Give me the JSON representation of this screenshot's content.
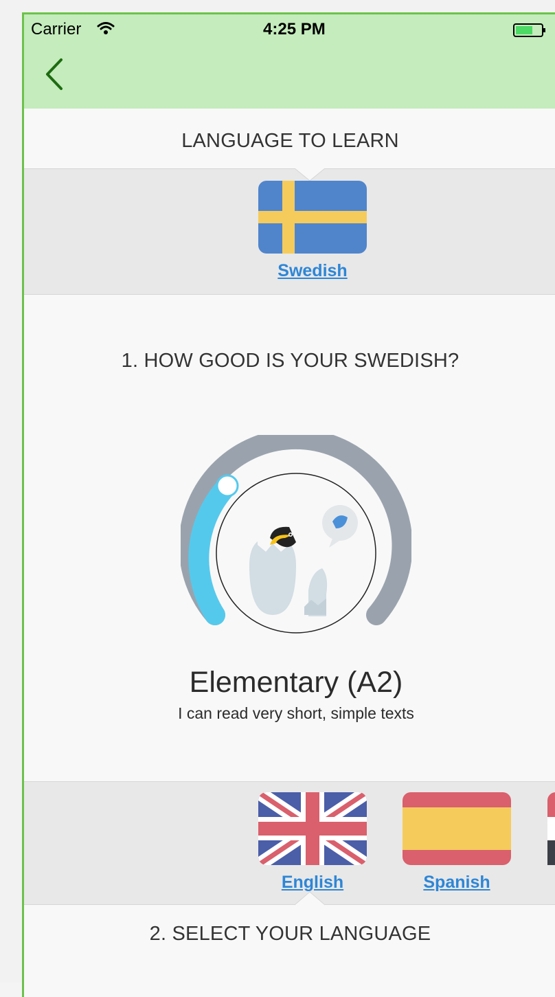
{
  "status_bar": {
    "carrier": "Carrier",
    "time": "4:25 PM"
  },
  "learn": {
    "section_title": "LANGUAGE TO LEARN",
    "selected": {
      "label": "Swedish",
      "flag": "sweden-flag-icon"
    }
  },
  "level": {
    "question": "1. HOW GOOD IS YOUR SWEDISH?",
    "title": "Elementary (A2)",
    "description": "I can read very short, simple texts",
    "slider_value_fraction": 0.22
  },
  "native": {
    "section_title": "2. SELECT YOUR LANGUAGE",
    "options": [
      {
        "label": "English",
        "flag": "uk-flag-icon"
      },
      {
        "label": "Spanish",
        "flag": "spain-flag-icon"
      }
    ]
  },
  "colors": {
    "nav_bg": "#c4ecbc",
    "accent_green": "#1e6b12",
    "link_blue": "#2e86d6",
    "slider_active": "#55c9ec",
    "slider_track": "#9aa3ad"
  }
}
